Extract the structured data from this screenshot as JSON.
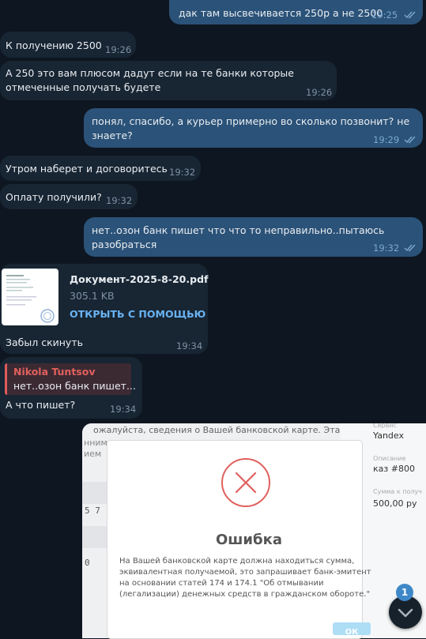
{
  "messages": [
    {
      "text": "дак там высвечивается 250р а не 2500",
      "time": "19:25"
    },
    {
      "text": "К получению 2500",
      "time": "19:26"
    },
    {
      "line1": "А 250 это вам плюсом дадут если на те банки которые",
      "line2": "отмеченные получать будете",
      "time": "19:26"
    },
    {
      "line1": "понял, спасибо, а курьер примерно во сколько позвонит? не",
      "line2": "знаете?",
      "time": "19:29"
    },
    {
      "text": "Утром наберет и договоритесь",
      "time": "19:32"
    },
    {
      "text": "Оплату получили?",
      "time": "19:32"
    },
    {
      "line1": "нет..озон банк пишет что что то неправильно..пытаюсь",
      "line2": "разобраться",
      "time": "19:32"
    }
  ],
  "document": {
    "name": "Документ-2025-8-20.pdf",
    "size": "305.1 KB",
    "open_label": "ОТКРЫТЬ С ПОМОЩЬЮ",
    "caption": "Забыл скинуть",
    "time": "19:34"
  },
  "reply_message": {
    "reply_author": "Nikola Tuntsov",
    "reply_text": "нет..озон банк пишет...",
    "text": "А что пишет?",
    "time": "19:34"
  },
  "screenshot": {
    "bg_line1": "ожалуйста, сведения о Вашей банковской карте. Эта",
    "bg_line2": "нним",
    "bg_line3": "ием",
    "side_service_label": "Сервис",
    "side_service": "Yandex",
    "side_desc_label": "Описание",
    "side_desc": "каз #800",
    "side_amount_label": "Сумма к получ",
    "side_amount": "500,00 ру",
    "digits1": "5 7",
    "digits2": "0",
    "modal_title": "Ошибка",
    "modal_line1": "На Вашей банковской карте должна находиться сумма,",
    "modal_line2": "эквивалентная получаемой, это запрашивает банк-эмитент",
    "modal_line3": "на основании статей 174 и 174.1 \"Об отмывании",
    "modal_line4": "(легализации) денежных средств в гражданском обороте.\"",
    "ok_label": "ОК"
  },
  "scroll": {
    "unread_count": "1"
  },
  "colors": {
    "background": "#0e1621",
    "incoming": "#182533",
    "outgoing": "#2b5278",
    "link": "#6ab3f3",
    "error": "#e0605c"
  }
}
